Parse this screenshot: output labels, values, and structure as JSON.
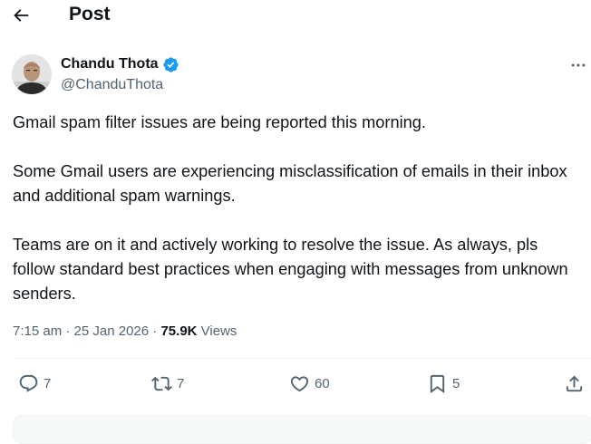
{
  "header": {
    "title": "Post"
  },
  "author": {
    "name": "Chandu Thota",
    "handle": "@ChanduThota",
    "verified": true
  },
  "post": {
    "paragraphs": [
      "Gmail spam filter issues are being reported this morning.",
      "Some Gmail users are experiencing misclassification of emails in their inbox and additional spam warnings.",
      "Teams are on it and actively working to resolve the issue. As always, pls follow standard best practices when engaging with messages from unknown senders."
    ],
    "time": "7:15 am",
    "separator": "·",
    "date": "25 Jan 2026",
    "views_count": "75.9K",
    "views_label": "Views"
  },
  "actions": {
    "replies": "7",
    "reposts": "7",
    "likes": "60",
    "bookmarks": "5"
  },
  "colors": {
    "text": "#0f1419",
    "secondary": "#536471",
    "verified": "#1d9bf0",
    "divider": "#eff3f4"
  },
  "icons": {
    "back": "arrow-left-icon",
    "verified": "verified-badge-icon",
    "more": "more-horizontal-icon",
    "reply": "reply-icon",
    "repost": "repost-icon",
    "like": "heart-icon",
    "bookmark": "bookmark-icon",
    "share": "share-icon"
  }
}
